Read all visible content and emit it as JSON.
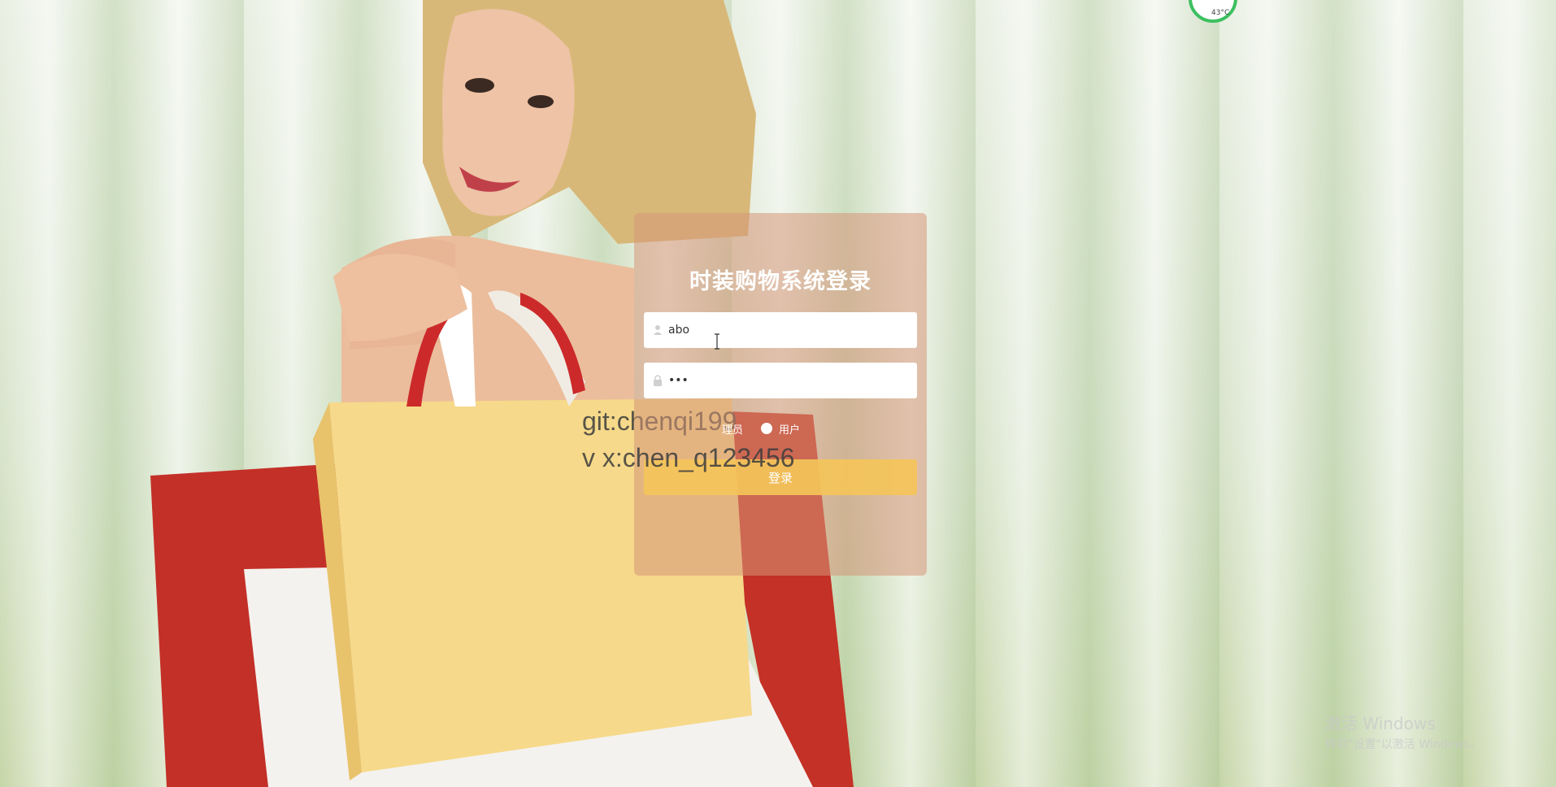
{
  "login": {
    "title": "时装购物系统登录",
    "username_value": "abo",
    "password_value": "•••",
    "role_admin_label": "理员",
    "role_user_label": "用户",
    "submit_label": "登录"
  },
  "overlay": {
    "git_text": "git:chenqi199",
    "vx_text": "v x:chen_q123456"
  },
  "system": {
    "activate_title": "激活 Windows",
    "activate_sub": "转到\"设置\"以激活 Windows。",
    "cpu_temp": "43°C"
  },
  "colors": {
    "panel": "#d6967855",
    "button": "#f4c45a",
    "title": "#ffffff"
  }
}
